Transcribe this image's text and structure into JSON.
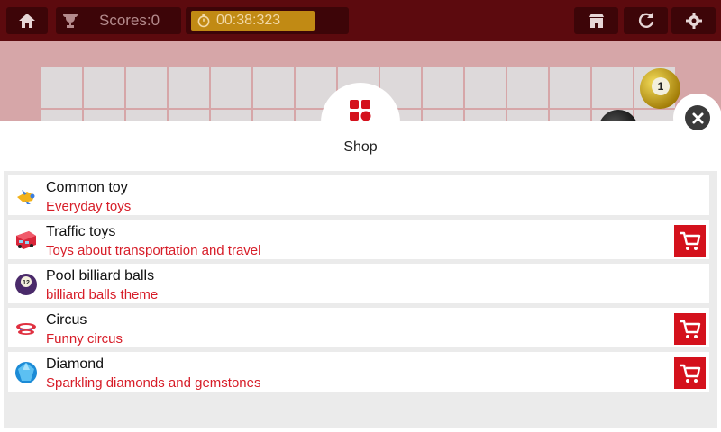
{
  "topbar": {
    "score_label": "Scores:0",
    "timer": "00:38:323",
    "icons": [
      "home-icon",
      "trophy-icon",
      "stopwatch-icon",
      "shop-icon",
      "refresh-icon",
      "gear-icon"
    ]
  },
  "board": {
    "visible_ball_number": "1"
  },
  "shop": {
    "title": "Shop",
    "items": [
      {
        "name": "Common toy",
        "desc": "Everyday toys",
        "owned": true,
        "icon": "airplane-toy-icon"
      },
      {
        "name": "Traffic toys",
        "desc": "Toys about transportation and travel",
        "owned": false,
        "icon": "bus-toy-icon"
      },
      {
        "name": "Pool billiard balls",
        "desc": "billiard balls theme",
        "owned": true,
        "icon": "billiard-ball-icon"
      },
      {
        "name": "Circus",
        "desc": "Funny circus",
        "owned": false,
        "icon": "circus-icon"
      },
      {
        "name": "Diamond",
        "desc": "Sparkling diamonds and gemstones",
        "owned": false,
        "icon": "diamond-icon"
      }
    ]
  },
  "colors": {
    "topbar": "#5c0a0e",
    "accent_red": "#d4111c",
    "desc_text": "#d71d28",
    "timer_bg": "#c18a14"
  }
}
